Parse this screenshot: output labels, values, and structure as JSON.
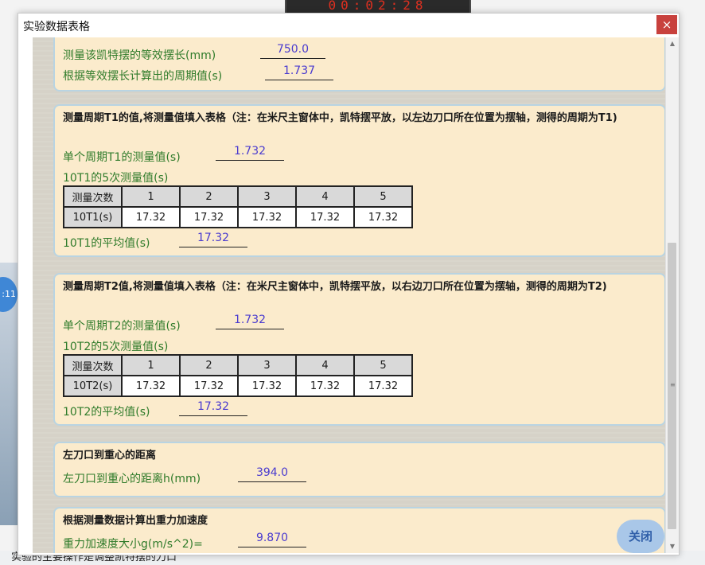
{
  "background": {
    "timer": "00:02:28",
    "side_badge": ":11",
    "bottom_text": "实验的主要操作是调整凯特摆的刀口"
  },
  "window": {
    "title": "实验数据表格",
    "close_glyph": "×"
  },
  "panel_top": {
    "equiv_length_label": "测量该凯特摆的等效摆长(mm)",
    "equiv_length_value": "750.0",
    "calc_period_label": "根据等效摆长计算出的周期值(s)",
    "calc_period_value": "1.737"
  },
  "panel_t1": {
    "heading": "测量周期T1的值,将测量值填入表格（注：在米尺主窗体中，凯特摆平放，以左边刀口所在位置为摆轴，测得的周期为T1)",
    "single_label": "单个周期T1的测量值(s)",
    "single_value": "1.732",
    "five_label": "10T1的5次测量值(s)",
    "table": {
      "header_label": "测量次数",
      "columns": [
        "1",
        "2",
        "3",
        "4",
        "5"
      ],
      "row_label": "10T1(s)",
      "values": [
        "17.32",
        "17.32",
        "17.32",
        "17.32",
        "17.32"
      ]
    },
    "avg_label": "10T1的平均值(s)",
    "avg_value": "17.32"
  },
  "panel_t2": {
    "heading": "测量周期T2值,将测量值填入表格（注：在米尺主窗体中，凯特摆平放，以右边刀口所在位置为摆轴，测得的周期为T2)",
    "single_label": "单个周期T2的测量值(s)",
    "single_value": "1.732",
    "five_label": "10T2的5次测量值(s)",
    "table": {
      "header_label": "测量次数",
      "columns": [
        "1",
        "2",
        "3",
        "4",
        "5"
      ],
      "row_label": "10T2(s)",
      "values": [
        "17.32",
        "17.32",
        "17.32",
        "17.32",
        "17.32"
      ]
    },
    "avg_label": "10T2的平均值(s)",
    "avg_value": "17.32"
  },
  "panel_h": {
    "heading": "左刀口到重心的距离",
    "label": "左刀口到重心的距离h(mm)",
    "value": "394.0"
  },
  "panel_g": {
    "heading": "根据测量数据计算出重力加速度",
    "label": "重力加速度大小g(m/s^2)=",
    "value": "9.870"
  },
  "close_button_label": "关闭",
  "colors": {
    "panel_bg": "#fbebcc",
    "panel_border": "#b9d4e2",
    "label_green": "#2f7b2a",
    "value_blue": "#4a3bcf",
    "close_red": "#c8413d"
  }
}
